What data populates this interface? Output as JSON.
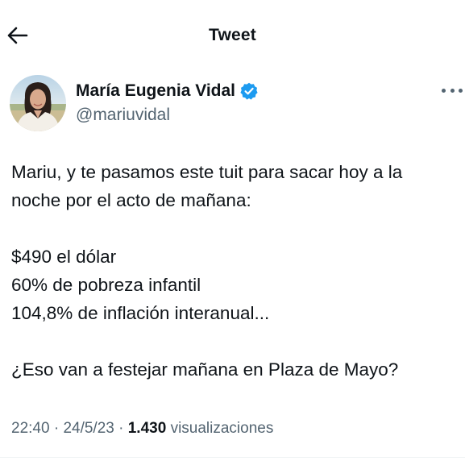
{
  "header": {
    "title": "Tweet",
    "back_icon": "arrow-left-icon"
  },
  "author": {
    "name": "María Eugenia Vidal",
    "handle": "@mariuvidal",
    "verified": true,
    "verified_color": "#1d9bf0"
  },
  "tweet": {
    "lines": [
      "Mariu, y te pasamos este tuit para sacar hoy a la",
      "noche por el acto de mañana:",
      "$490 el dólar",
      "60% de pobreza infantil",
      "104,8% de inflación interanual...",
      "¿Eso van a festejar mañana en Plaza de Mayo?"
    ]
  },
  "meta": {
    "time": "22:40",
    "date": "24/5/23",
    "separator": " · ",
    "views_count": "1.430",
    "views_label": "visualizaciones"
  },
  "colors": {
    "text": "#0f1419",
    "secondary": "#536471"
  }
}
